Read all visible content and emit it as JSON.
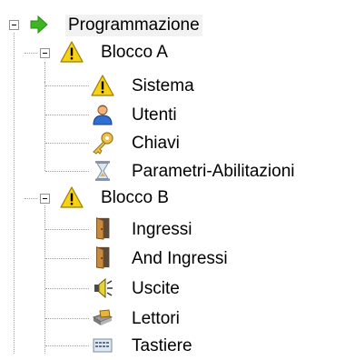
{
  "tree": {
    "root": {
      "label": "Programmazione",
      "icon": "green-arrow-icon",
      "expanded": true
    },
    "blocco_a": {
      "label": "Blocco A",
      "icon": "warning-icon",
      "expanded": true,
      "children": [
        {
          "label": "Sistema",
          "icon": "warning-icon"
        },
        {
          "label": "Utenti",
          "icon": "user-icon"
        },
        {
          "label": "Chiavi",
          "icon": "key-icon"
        },
        {
          "label": "Parametri-Abilitazioni",
          "icon": "hourglass-icon"
        }
      ]
    },
    "blocco_b": {
      "label": "Blocco B",
      "icon": "warning-icon",
      "expanded": true,
      "children": [
        {
          "label": "Ingressi",
          "icon": "door-icon"
        },
        {
          "label": "And Ingressi",
          "icon": "door-icon"
        },
        {
          "label": "Uscite",
          "icon": "speaker-icon"
        },
        {
          "label": "Lettori",
          "icon": "card-reader-icon"
        },
        {
          "label": "Tastiere",
          "icon": "keyboard-icon"
        }
      ]
    }
  },
  "colors": {
    "warning_yellow": "#f7d117",
    "arrow_green": "#3cb521",
    "root_highlight": "#f2f2f2",
    "tree_lines": "#a0a0a0"
  }
}
